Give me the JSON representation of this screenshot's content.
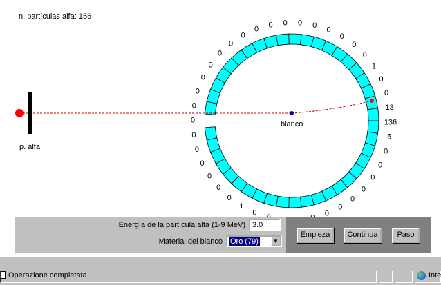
{
  "counter": {
    "label": "n. partículas alfa:",
    "value": "156"
  },
  "source_label": "p. alfa",
  "target_label": "blanco",
  "detector_counts": {
    "ring": [
      "13",
      "136",
      "5",
      "0",
      "0",
      "0",
      "0",
      "0",
      "0",
      "0",
      "0",
      "0",
      "0",
      "0",
      "0",
      "1",
      "0",
      "0",
      "0",
      "0",
      "0",
      "0",
      "0",
      "0",
      "0",
      "0",
      "0",
      "0",
      "0",
      "0",
      "0",
      "0",
      "0",
      "0",
      "0",
      "0",
      "0",
      "0",
      "0",
      "1",
      "0",
      "0"
    ]
  },
  "controls": {
    "energy_label": "Energía de la partícula alfa (1-9 MeV)",
    "energy_value": "3.0",
    "material_label": "Material del blanco",
    "material_value": "Oro (79)"
  },
  "buttons": {
    "start": "Empieza",
    "continue": "Continua",
    "step": "Paso"
  },
  "status": {
    "text": "Operazione completata",
    "zone": "Inte"
  },
  "colors": {
    "ring_fill": "#00ffff",
    "particle": "#ff0000",
    "target": "#0000c0",
    "trajectory": "#cc0000"
  }
}
